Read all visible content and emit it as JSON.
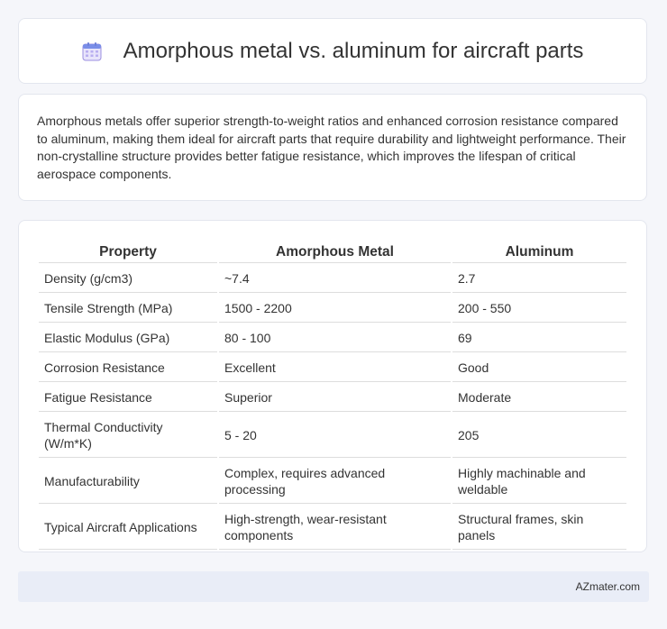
{
  "header": {
    "title": "Amorphous metal vs. aluminum for aircraft parts",
    "icon": "calendar-icon"
  },
  "intro": {
    "text": "Amorphous metals offer superior strength-to-weight ratios and enhanced corrosion resistance compared to aluminum, making them ideal for aircraft parts that require durability and lightweight performance. Their non-crystalline structure provides better fatigue resistance, which improves the lifespan of critical aerospace components."
  },
  "table": {
    "headers": [
      "Property",
      "Amorphous Metal",
      "Aluminum"
    ],
    "rows": [
      [
        "Density (g/cm3)",
        "~7.4",
        "2.7"
      ],
      [
        "Tensile Strength (MPa)",
        "1500 - 2200",
        "200 - 550"
      ],
      [
        "Elastic Modulus (GPa)",
        "80 - 100",
        "69"
      ],
      [
        "Corrosion Resistance",
        "Excellent",
        "Good"
      ],
      [
        "Fatigue Resistance",
        "Superior",
        "Moderate"
      ],
      [
        "Thermal Conductivity (W/m*K)",
        "5 - 20",
        "205"
      ],
      [
        "Manufacturability",
        "Complex, requires advanced processing",
        "Highly machinable and weldable"
      ],
      [
        "Typical Aircraft Applications",
        "High-strength, wear-resistant components",
        "Structural frames, skin panels"
      ]
    ]
  },
  "footer": {
    "brand": "AZmater.com"
  }
}
